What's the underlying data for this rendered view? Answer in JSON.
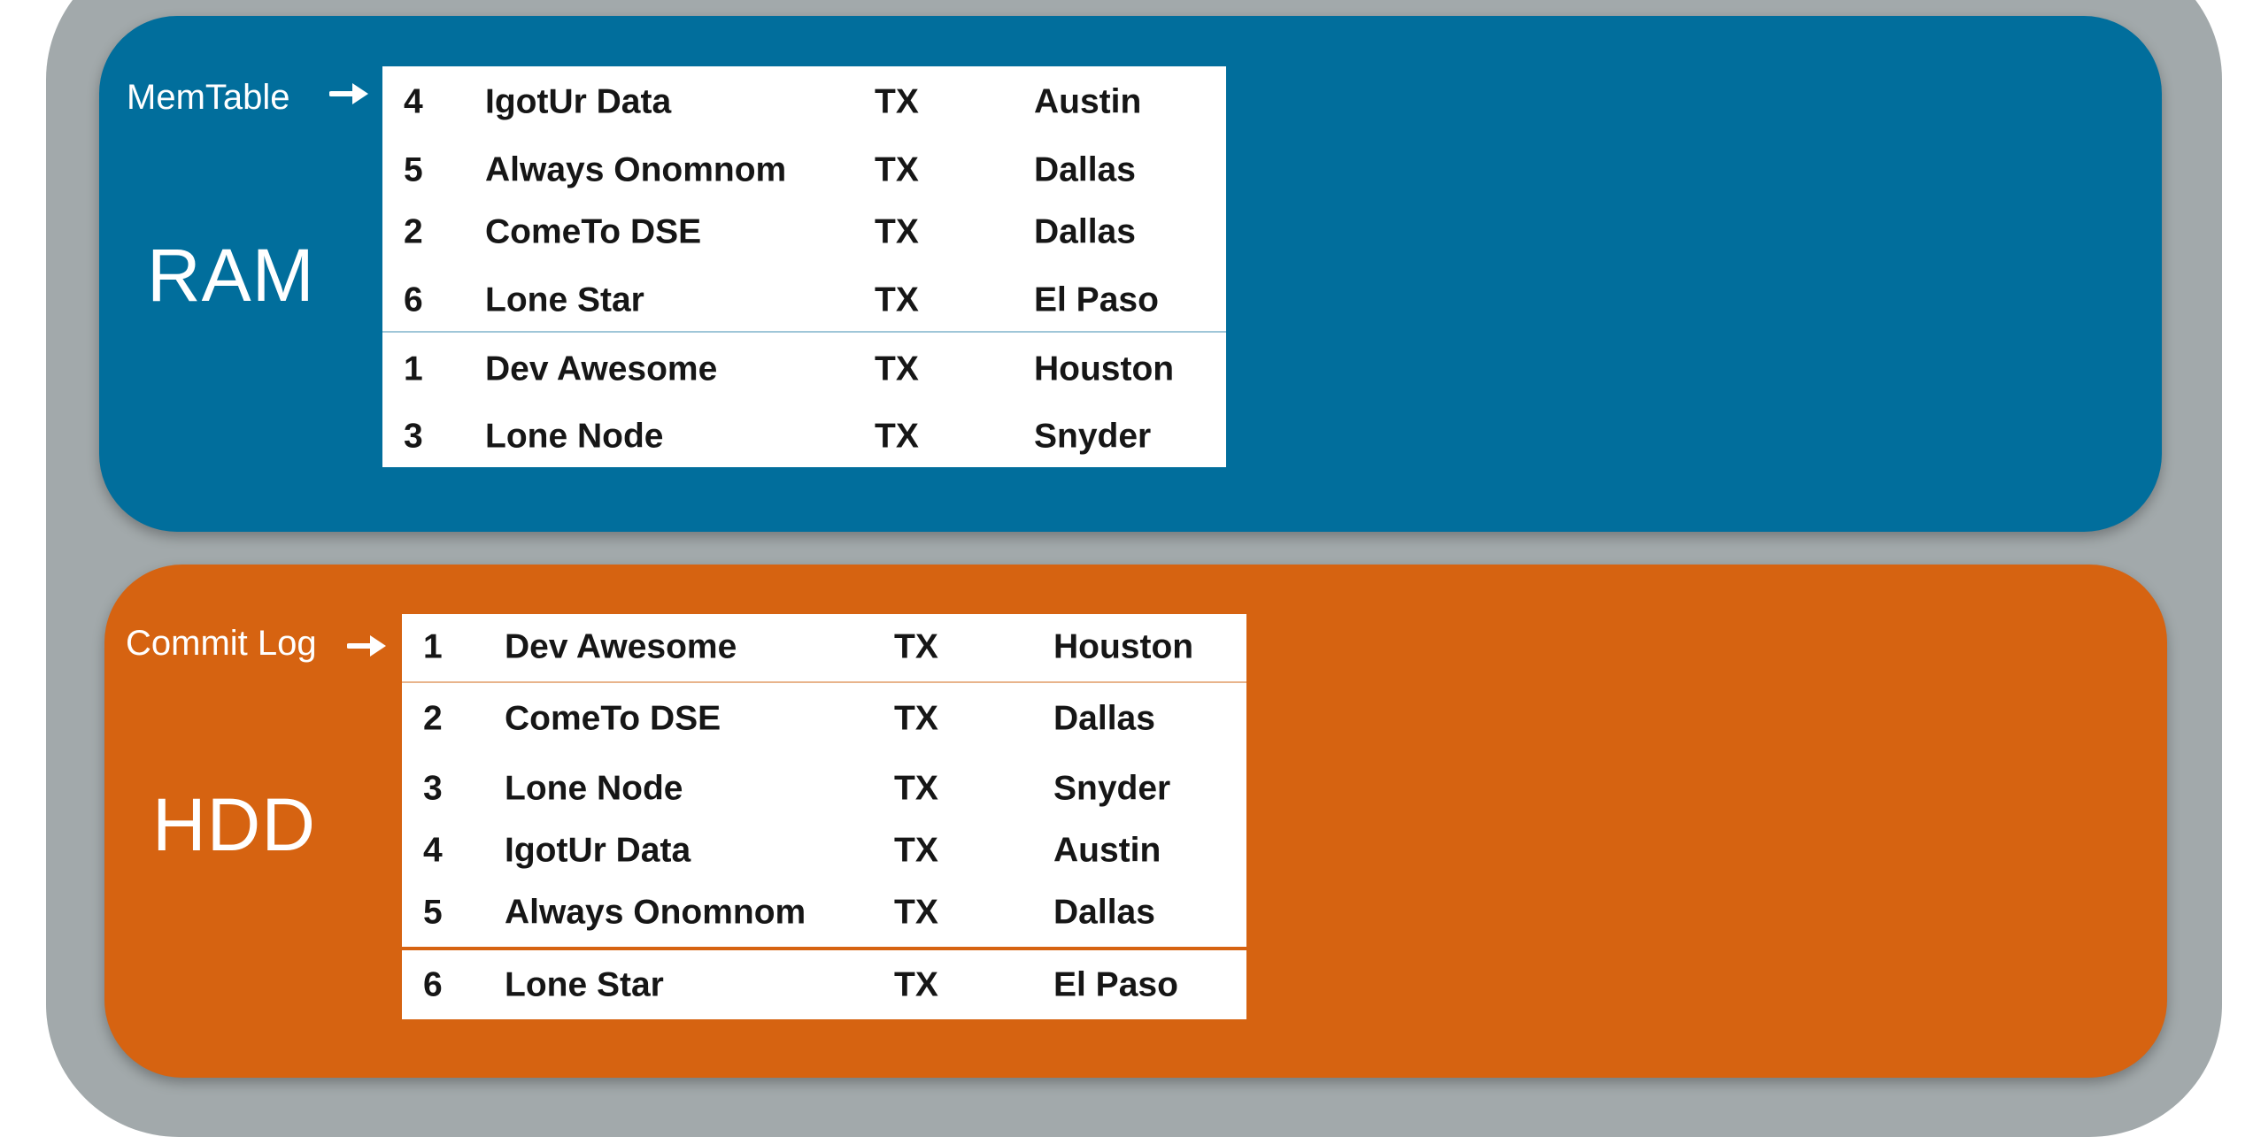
{
  "ram": {
    "label": "RAM",
    "table_label": "MemTable",
    "rows": [
      {
        "id": "4",
        "name": "IgotUr Data",
        "state": "TX",
        "city": "Austin"
      },
      {
        "id": "5",
        "name": "Always Onomnom",
        "state": "TX",
        "city": "Dallas"
      },
      {
        "id": "2",
        "name": "ComeTo DSE",
        "state": "TX",
        "city": "Dallas"
      },
      {
        "id": "6",
        "name": "Lone Star",
        "state": "TX",
        "city": "El Paso"
      },
      {
        "id": "1",
        "name": "Dev Awesome",
        "state": "TX",
        "city": "Houston"
      },
      {
        "id": "3",
        "name": "Lone Node",
        "state": "TX",
        "city": "Snyder"
      }
    ]
  },
  "hdd": {
    "label": "HDD",
    "table_label": "Commit Log",
    "rows": [
      {
        "id": "1",
        "name": "Dev Awesome",
        "state": "TX",
        "city": "Houston"
      },
      {
        "id": "2",
        "name": "ComeTo DSE",
        "state": "TX",
        "city": "Dallas"
      },
      {
        "id": "3",
        "name": "Lone Node",
        "state": "TX",
        "city": "Snyder"
      },
      {
        "id": "4",
        "name": "IgotUr Data",
        "state": "TX",
        "city": "Austin"
      },
      {
        "id": "5",
        "name": "Always Onomnom",
        "state": "TX",
        "city": "Dallas"
      },
      {
        "id": "6",
        "name": "Lone Star",
        "state": "TX",
        "city": "El Paso"
      }
    ]
  },
  "colors": {
    "frame": "#a2a9ab",
    "ram_panel": "#016e9c",
    "hdd_panel": "#d66311",
    "table_bg": "#ffffff",
    "text_dark": "#161616"
  },
  "icons": {
    "table_pointer": "arrow-right-icon"
  }
}
